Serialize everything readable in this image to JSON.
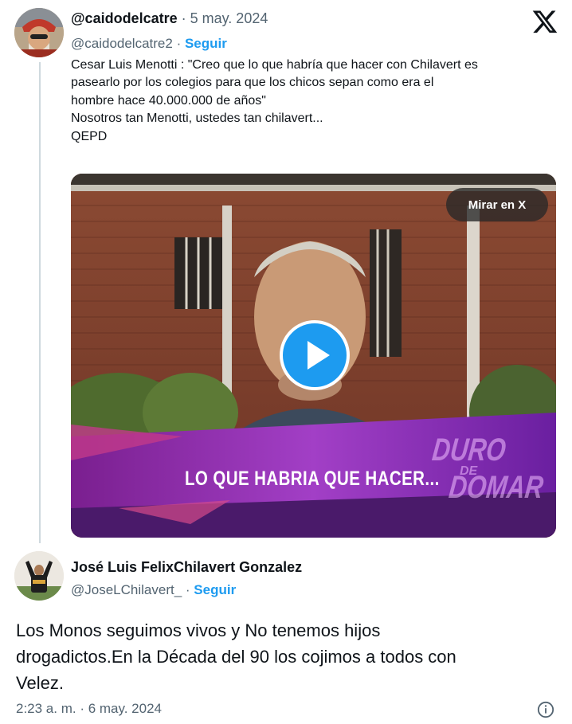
{
  "embedded_tweet": {
    "author": {
      "display_name": "@caidodelcatre",
      "date": "5 may. 2024",
      "handle": "@caidodelcatre2",
      "follow_label": "Seguir"
    },
    "text_lines": [
      "Cesar Luis Menotti : \"Creo que lo que habría que hacer con Chilavert es",
      "pasearlo por los colegios para que los chicos sepan como era el",
      "hombre hace 40.000.000 de años\"",
      "Nosotros tan Menotti,  ustedes tan chilavert...",
      "QEPD"
    ],
    "video": {
      "watch_label": "Mirar en X",
      "caption": "LO QUE HABRIA QUE HACER...",
      "logo_line1": "DURO",
      "logo_line2": "DE",
      "logo_line3": "DOMAR"
    }
  },
  "reply_tweet": {
    "author": {
      "display_name": "José Luis FelixChilavert Gonzalez",
      "handle": "@JoseLChilavert_",
      "follow_label": "Seguir"
    },
    "text_lines": [
      "Los Monos seguimos vivos y No tenemos hijos",
      "drogadictos.En la Década del 90 los cojimos a todos con",
      "Velez."
    ],
    "timestamp": "2:23 a. m. · 6 may. 2024"
  },
  "icons": {
    "platform": "x-logo-icon",
    "info": "info-icon",
    "play": "play-icon"
  },
  "colors": {
    "link_blue": "#1d9bf0",
    "muted_text": "#536471",
    "primary_text": "#0f1419",
    "thread_line": "#cfd9de"
  }
}
